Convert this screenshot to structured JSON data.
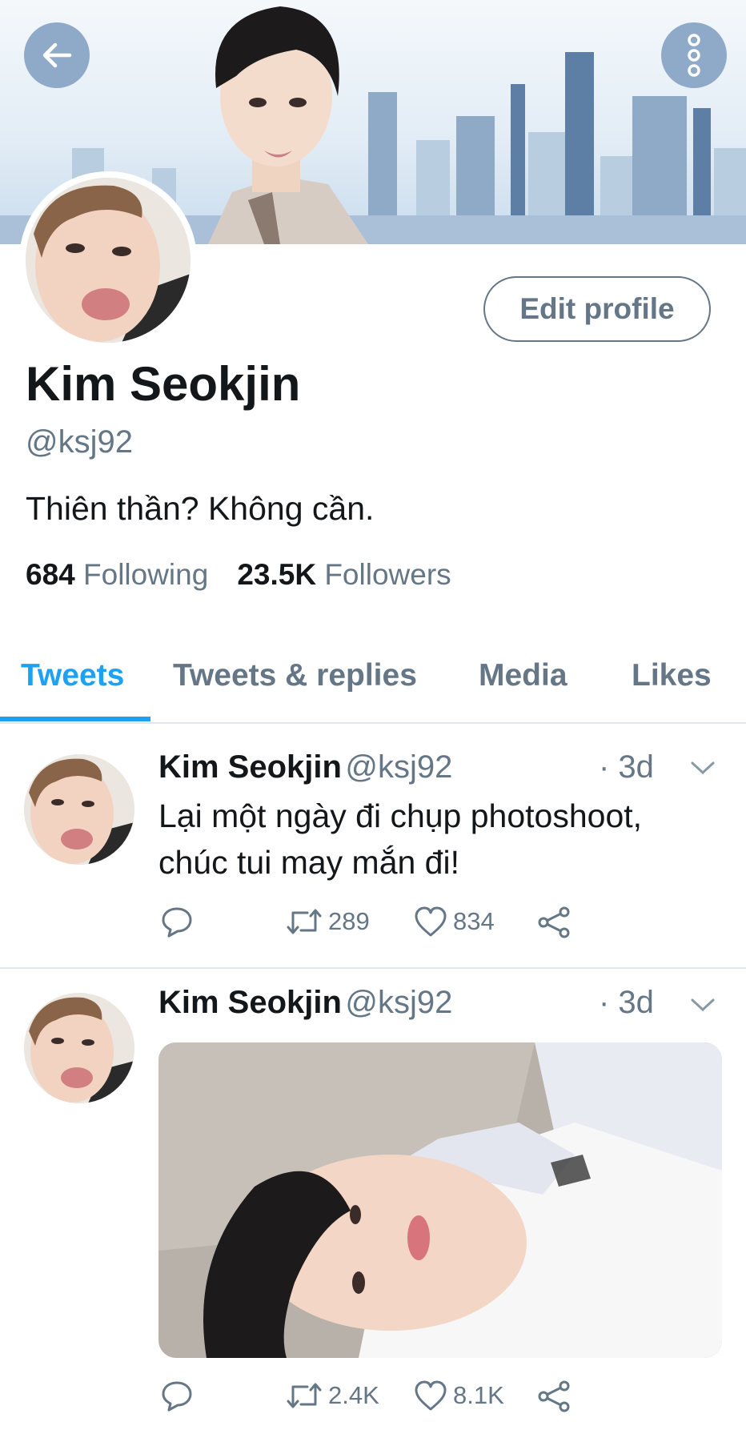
{
  "header": {
    "back_icon": "arrow-left-icon",
    "more_icon": "more-vertical-icon",
    "accent": "#8fa9c8"
  },
  "profile": {
    "edit_label": "Edit profile",
    "display_name": "Kim Seokjin",
    "handle": "@ksj92",
    "bio": "Thiên thần? Không cần.",
    "following_count": "684",
    "following_label": "Following",
    "followers_count": "23.5K",
    "followers_label": "Followers"
  },
  "tabs": [
    {
      "label": "Tweets",
      "active": true
    },
    {
      "label": "Tweets & replies",
      "active": false
    },
    {
      "label": "Media",
      "active": false
    },
    {
      "label": "Likes",
      "active": false
    }
  ],
  "tweets": [
    {
      "name": "Kim Seokjin",
      "handle": "@ksj92",
      "time": "· 3d",
      "text_line1": "Lại một ngày đi chụp photoshoot,",
      "text_line2": "chúc tui may mắn đi!",
      "retweets": "289",
      "likes": "834"
    },
    {
      "name": "Kim Seokjin",
      "handle": "@ksj92",
      "time": "· 3d",
      "retweets": "2.4K",
      "likes": "8.1K"
    }
  ],
  "colors": {
    "accent_blue": "#1da1f2",
    "secondary_text": "#657786",
    "divider": "#e1e8ed"
  }
}
